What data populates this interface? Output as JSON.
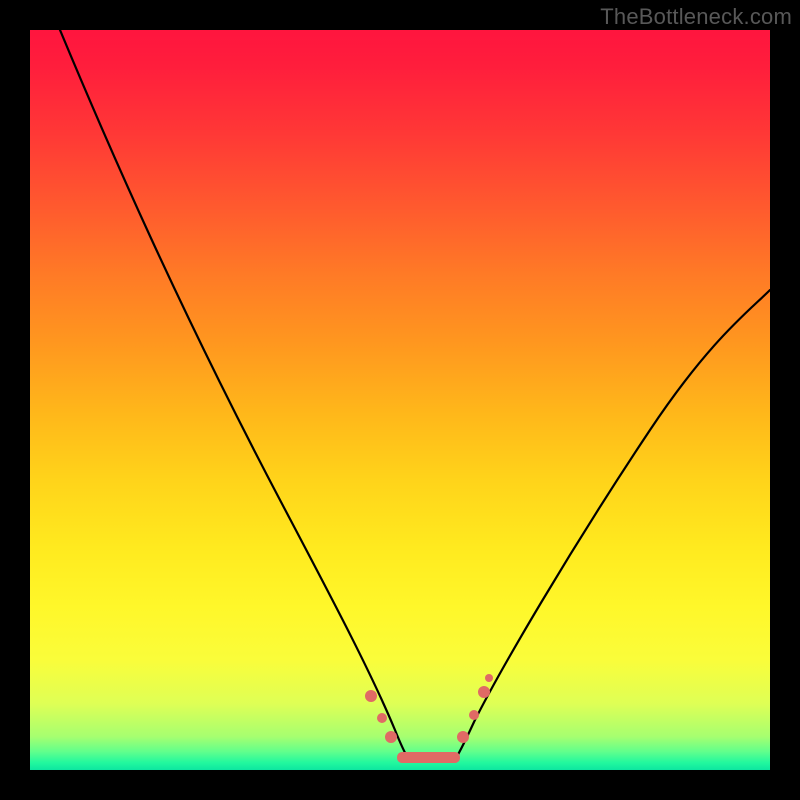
{
  "watermark": "TheBottleneck.com",
  "chart_data": {
    "type": "line",
    "title": "",
    "xlabel": "",
    "ylabel": "",
    "xlim": [
      0,
      100
    ],
    "ylim": [
      0,
      100
    ],
    "series": [
      {
        "name": "left-curve",
        "x": [
          4,
          8,
          12,
          16,
          20,
          24,
          28,
          32,
          36,
          40,
          44,
          47,
          49,
          50.5
        ],
        "y": [
          100,
          92,
          84,
          76,
          68,
          60,
          52,
          44,
          36,
          28,
          20,
          12,
          6,
          2
        ]
      },
      {
        "name": "right-curve",
        "x": [
          57.5,
          59,
          61,
          64,
          68,
          72,
          76,
          80,
          84,
          88,
          92,
          96,
          100
        ],
        "y": [
          2,
          5,
          9,
          15,
          22,
          29,
          35,
          41,
          47,
          52,
          57,
          61,
          65
        ]
      },
      {
        "name": "floor",
        "x": [
          50.5,
          52,
          54,
          56,
          57.5
        ],
        "y": [
          2,
          1.5,
          1.5,
          1.5,
          2
        ]
      }
    ],
    "markers": [
      {
        "x": 46.0,
        "y": 10.0,
        "r": 5
      },
      {
        "x": 47.5,
        "y": 7.0,
        "r": 4
      },
      {
        "x": 48.8,
        "y": 4.5,
        "r": 5
      },
      {
        "x": 58.5,
        "y": 4.5,
        "r": 5
      },
      {
        "x": 60.0,
        "y": 7.5,
        "r": 4
      },
      {
        "x": 61.3,
        "y": 10.5,
        "r": 5
      },
      {
        "x": 62.0,
        "y": 12.5,
        "r": 3
      }
    ],
    "floor_bar": {
      "x0": 49.5,
      "x1": 58.0,
      "y": 2.0,
      "h": 2.0
    },
    "gradient_stops": [
      {
        "pos": 0,
        "color": "#ff153e"
      },
      {
        "pos": 50,
        "color": "#ffc81a"
      },
      {
        "pos": 80,
        "color": "#fff72a"
      },
      {
        "pos": 100,
        "color": "#0de6a0"
      }
    ]
  }
}
